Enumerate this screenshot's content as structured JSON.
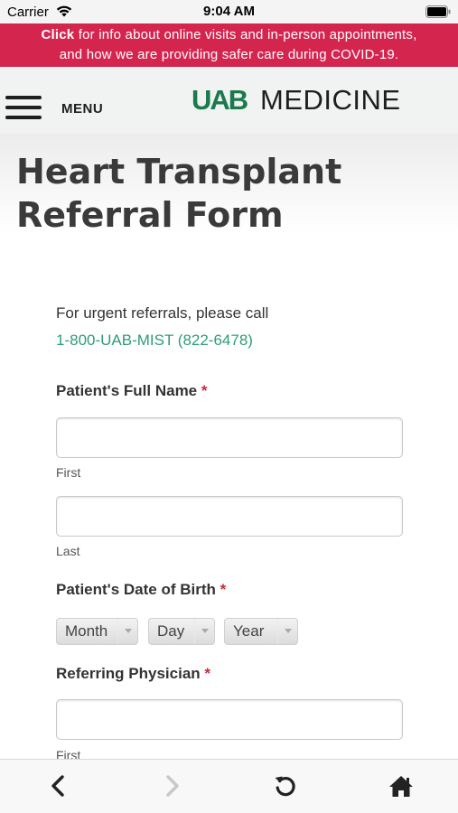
{
  "status_bar": {
    "carrier": "Carrier",
    "time": "9:04 AM",
    "icons": [
      "wifi-icon",
      "battery-icon"
    ]
  },
  "banner": {
    "link_text": "Click",
    "line1_rest": " for info about online visits and in-person appointments,",
    "line2": "and how we are providing safer care during COVID-19.",
    "color": "#d4254f"
  },
  "header": {
    "menu_label": "MENU",
    "logo_uab": "UAB",
    "logo_medicine": "MEDICINE",
    "logo_color": "#1a7a4c"
  },
  "page": {
    "title_line1": "Heart Transplant",
    "title_line2": "Referral Form"
  },
  "form": {
    "urgent_text": "For urgent referrals, please call",
    "phone": "1-800-UAB-MIST (822-6478)",
    "required_marker": "*",
    "patient_name": {
      "label": "Patient's Full Name",
      "first_label": "First",
      "last_label": "Last"
    },
    "dob": {
      "label": "Patient's Date of Birth",
      "month": "Month",
      "day": "Day",
      "year": "Year"
    },
    "referring_physician": {
      "label": "Referring Physician",
      "first_label": "First"
    },
    "accent_color": "#2e9c77",
    "required_color": "#c42c39"
  },
  "toolbar": {
    "icons": [
      "back-icon",
      "forward-icon",
      "reload-icon",
      "home-icon"
    ]
  }
}
